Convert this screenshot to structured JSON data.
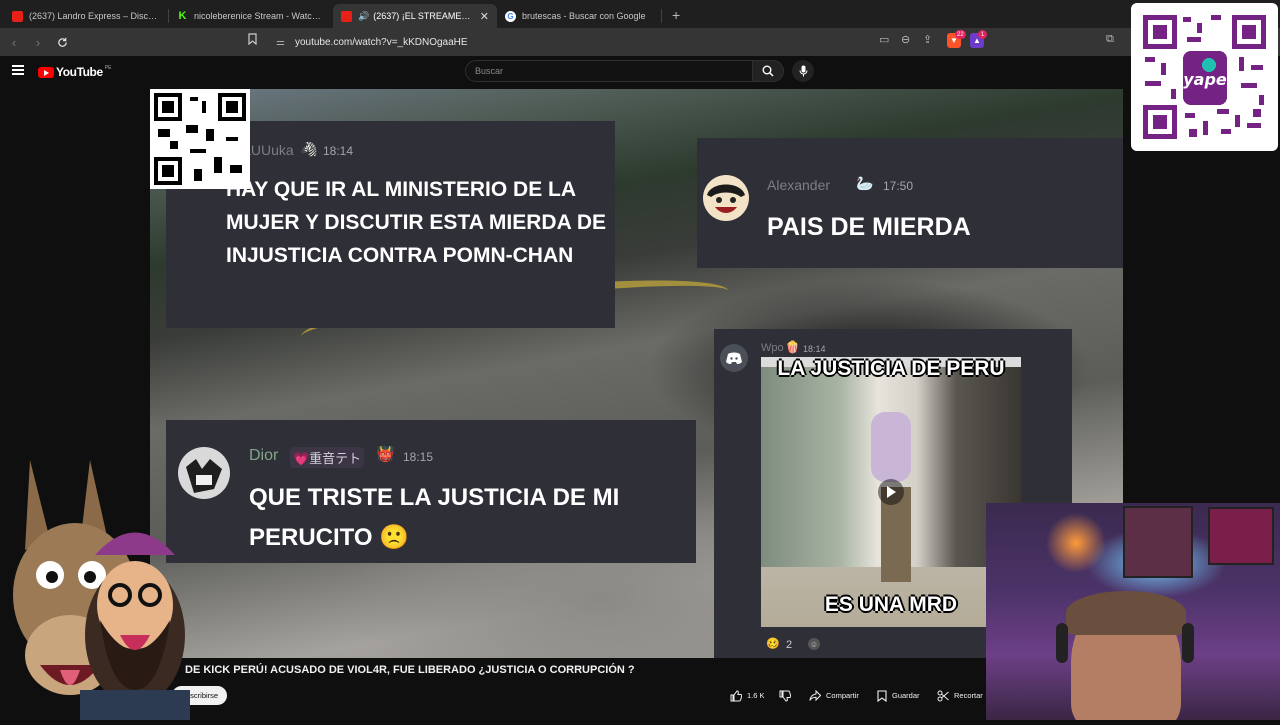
{
  "browser": {
    "tabs": [
      {
        "title": "(2637) Landro Express – Disco Sentir",
        "favicon": "youtube",
        "active": false
      },
      {
        "title": "nicoleberenice Stream - Watch Live o",
        "favicon": "kick",
        "active": false
      },
      {
        "title": "(2637) ¡EL STREAMER MÁS EN",
        "favicon": "youtube",
        "active": true,
        "audio": true
      },
      {
        "title": "brutescas - Buscar con Google",
        "favicon": "google",
        "active": false
      }
    ],
    "new_tab": "+",
    "url": "youtube.com/watch?v=_kKDNOgaaHE",
    "brave_badge": "22",
    "rewards_badge": "1"
  },
  "youtube": {
    "logo_text": "YouTube",
    "logo_country": "PE",
    "search_placeholder": "Buscar"
  },
  "video": {
    "chats": [
      {
        "user": "UkaUUuka",
        "emoji": "🦓",
        "time": "18:14",
        "message": "HAY QUE IR AL MINISTERIO DE LA MUJER Y DISCUTIR ESTA MIERDA DE INJUSTICIA CONTRA POMN-CHAN"
      },
      {
        "user": "Alexander",
        "emoji": "🦢",
        "time": "17:50",
        "message": "PAIS DE MIERDA"
      },
      {
        "user": "Dior",
        "tag": "💗重音テト",
        "emoji": "👹",
        "time": "18:15",
        "message": "QUE TRISTE LA JUSTICIA DE MI PERUCITO 🙁"
      },
      {
        "user": "Wpo",
        "emoji": "🍿",
        "time": "18:14",
        "meme_top": "LA JUSTICIA DE PERU",
        "meme_bottom": "ES UNA MRD",
        "reaction_count": "2"
      }
    ]
  },
  "info": {
    "title": "DE KICK PERÚ! ACUSADO DE VIOL4R, FUE LIBERADO ¿JUSTICIA O CORRUPCIÓN ?",
    "subscribe": "Suscribirse",
    "likes": "1.6 K",
    "share": "Compartir",
    "save": "Guardar",
    "clip": "Recortar"
  },
  "overlay": {
    "qr_brand": "yape"
  },
  "colors": {
    "bg": "#0f0f0f",
    "chat_bg": "#2e2f37",
    "yape": "#742284"
  }
}
